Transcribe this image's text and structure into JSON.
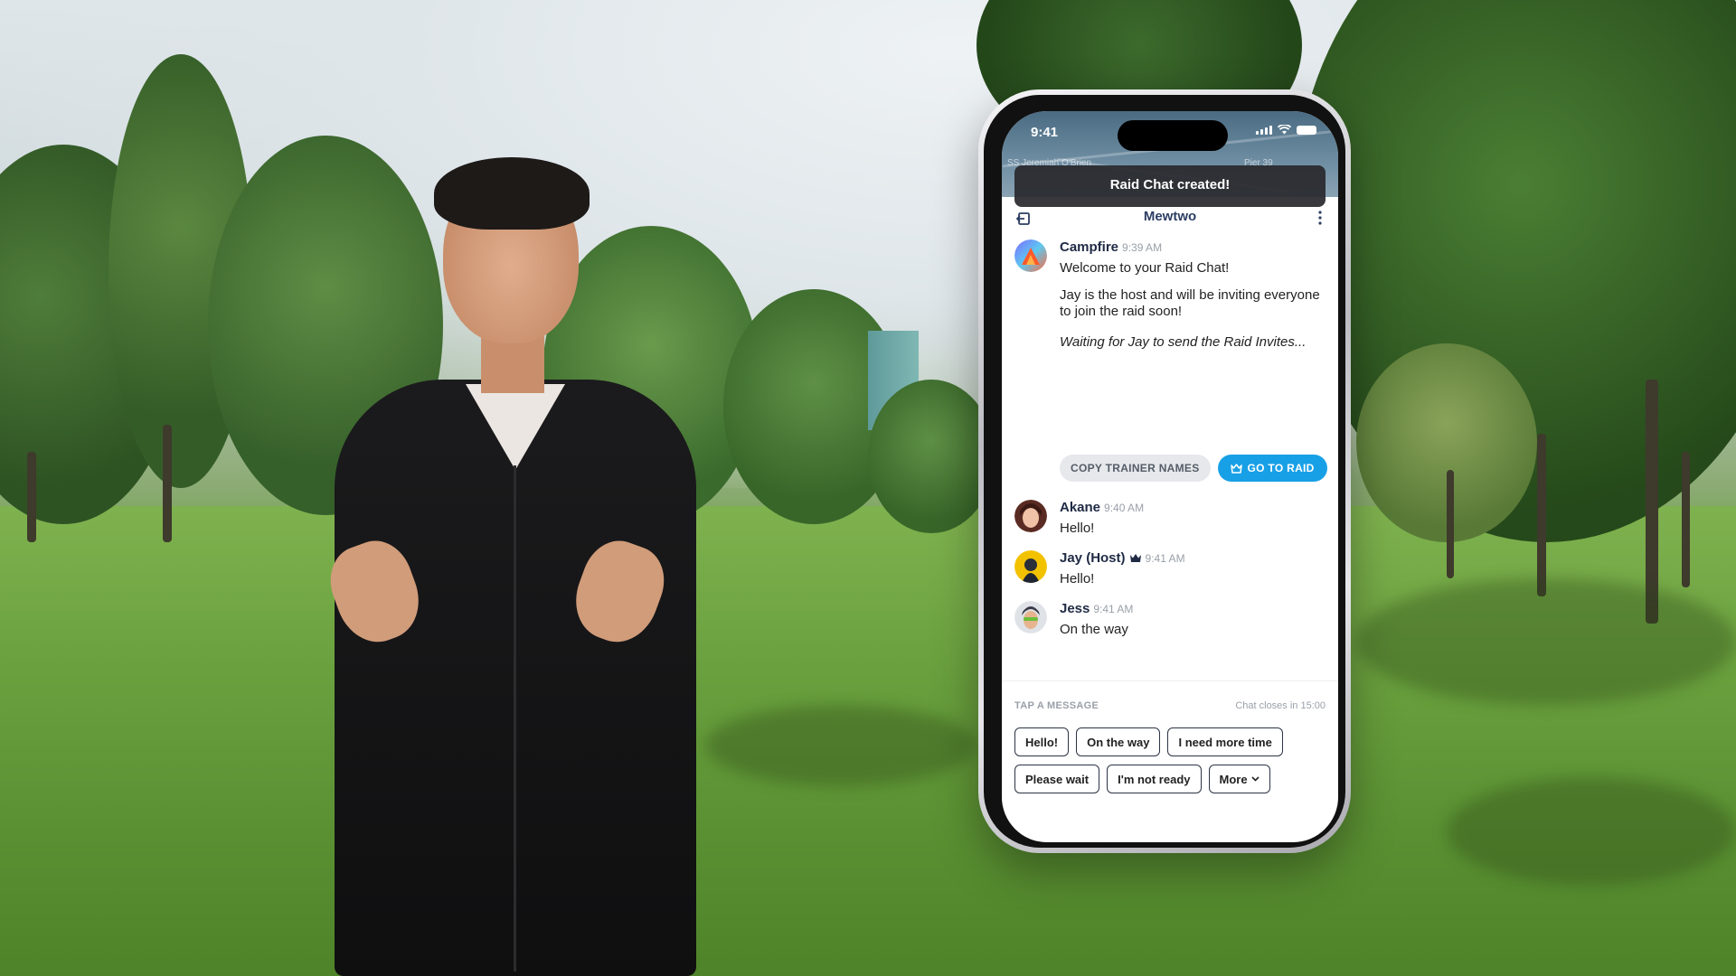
{
  "status_bar": {
    "time": "9:41"
  },
  "map": {
    "label_left": "SS Jeremiah O'Brien",
    "label_right": "Pier 39"
  },
  "toast": {
    "text": "Raid Chat created!"
  },
  "header": {
    "title": "Mewtwo"
  },
  "messages": [
    {
      "name": "Campfire",
      "time": "9:39 AM",
      "lines": [
        "Welcome to your Raid Chat!",
        "Jay is the host and will be inviting everyone to join the raid soon!",
        "Waiting for Jay to send the Raid Invites..."
      ]
    },
    {
      "name": "Akane",
      "time": "9:40 AM",
      "text": "Hello!"
    },
    {
      "name": "Jay (Host)",
      "time": "9:41 AM",
      "text": "Hello!"
    },
    {
      "name": "Jess",
      "time": "9:41 AM",
      "text": "On the way"
    }
  ],
  "actions": {
    "copy": "COPY TRAINER NAMES",
    "raid": "GO TO RAID"
  },
  "quick_replies": {
    "label": "TAP A MESSAGE",
    "closes": "Chat closes in 15:00",
    "row1": [
      "Hello!",
      "On the way",
      "I need more time"
    ],
    "row2": [
      "Please wait",
      "I'm not ready",
      "More"
    ]
  },
  "colors": {
    "accent": "#18a0e6",
    "header_text": "#2c3e63",
    "toast_bg": "#28282c"
  }
}
